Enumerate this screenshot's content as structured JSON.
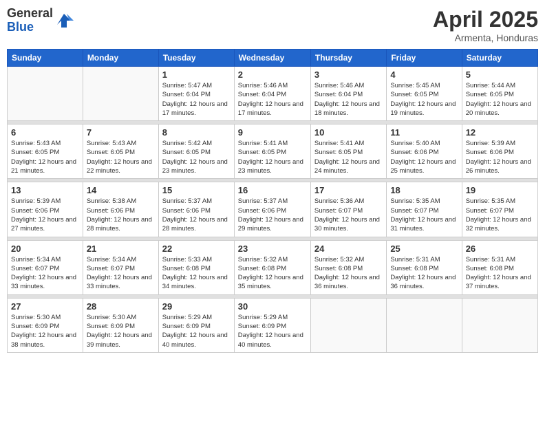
{
  "header": {
    "logo_general": "General",
    "logo_blue": "Blue",
    "month": "April 2025",
    "location": "Armenta, Honduras"
  },
  "days_of_week": [
    "Sunday",
    "Monday",
    "Tuesday",
    "Wednesday",
    "Thursday",
    "Friday",
    "Saturday"
  ],
  "weeks": [
    [
      {
        "day": "",
        "info": ""
      },
      {
        "day": "",
        "info": ""
      },
      {
        "day": "1",
        "info": "Sunrise: 5:47 AM\nSunset: 6:04 PM\nDaylight: 12 hours and 17 minutes."
      },
      {
        "day": "2",
        "info": "Sunrise: 5:46 AM\nSunset: 6:04 PM\nDaylight: 12 hours and 17 minutes."
      },
      {
        "day": "3",
        "info": "Sunrise: 5:46 AM\nSunset: 6:04 PM\nDaylight: 12 hours and 18 minutes."
      },
      {
        "day": "4",
        "info": "Sunrise: 5:45 AM\nSunset: 6:05 PM\nDaylight: 12 hours and 19 minutes."
      },
      {
        "day": "5",
        "info": "Sunrise: 5:44 AM\nSunset: 6:05 PM\nDaylight: 12 hours and 20 minutes."
      }
    ],
    [
      {
        "day": "6",
        "info": "Sunrise: 5:43 AM\nSunset: 6:05 PM\nDaylight: 12 hours and 21 minutes."
      },
      {
        "day": "7",
        "info": "Sunrise: 5:43 AM\nSunset: 6:05 PM\nDaylight: 12 hours and 22 minutes."
      },
      {
        "day": "8",
        "info": "Sunrise: 5:42 AM\nSunset: 6:05 PM\nDaylight: 12 hours and 23 minutes."
      },
      {
        "day": "9",
        "info": "Sunrise: 5:41 AM\nSunset: 6:05 PM\nDaylight: 12 hours and 23 minutes."
      },
      {
        "day": "10",
        "info": "Sunrise: 5:41 AM\nSunset: 6:05 PM\nDaylight: 12 hours and 24 minutes."
      },
      {
        "day": "11",
        "info": "Sunrise: 5:40 AM\nSunset: 6:06 PM\nDaylight: 12 hours and 25 minutes."
      },
      {
        "day": "12",
        "info": "Sunrise: 5:39 AM\nSunset: 6:06 PM\nDaylight: 12 hours and 26 minutes."
      }
    ],
    [
      {
        "day": "13",
        "info": "Sunrise: 5:39 AM\nSunset: 6:06 PM\nDaylight: 12 hours and 27 minutes."
      },
      {
        "day": "14",
        "info": "Sunrise: 5:38 AM\nSunset: 6:06 PM\nDaylight: 12 hours and 28 minutes."
      },
      {
        "day": "15",
        "info": "Sunrise: 5:37 AM\nSunset: 6:06 PM\nDaylight: 12 hours and 28 minutes."
      },
      {
        "day": "16",
        "info": "Sunrise: 5:37 AM\nSunset: 6:06 PM\nDaylight: 12 hours and 29 minutes."
      },
      {
        "day": "17",
        "info": "Sunrise: 5:36 AM\nSunset: 6:07 PM\nDaylight: 12 hours and 30 minutes."
      },
      {
        "day": "18",
        "info": "Sunrise: 5:35 AM\nSunset: 6:07 PM\nDaylight: 12 hours and 31 minutes."
      },
      {
        "day": "19",
        "info": "Sunrise: 5:35 AM\nSunset: 6:07 PM\nDaylight: 12 hours and 32 minutes."
      }
    ],
    [
      {
        "day": "20",
        "info": "Sunrise: 5:34 AM\nSunset: 6:07 PM\nDaylight: 12 hours and 33 minutes."
      },
      {
        "day": "21",
        "info": "Sunrise: 5:34 AM\nSunset: 6:07 PM\nDaylight: 12 hours and 33 minutes."
      },
      {
        "day": "22",
        "info": "Sunrise: 5:33 AM\nSunset: 6:08 PM\nDaylight: 12 hours and 34 minutes."
      },
      {
        "day": "23",
        "info": "Sunrise: 5:32 AM\nSunset: 6:08 PM\nDaylight: 12 hours and 35 minutes."
      },
      {
        "day": "24",
        "info": "Sunrise: 5:32 AM\nSunset: 6:08 PM\nDaylight: 12 hours and 36 minutes."
      },
      {
        "day": "25",
        "info": "Sunrise: 5:31 AM\nSunset: 6:08 PM\nDaylight: 12 hours and 36 minutes."
      },
      {
        "day": "26",
        "info": "Sunrise: 5:31 AM\nSunset: 6:08 PM\nDaylight: 12 hours and 37 minutes."
      }
    ],
    [
      {
        "day": "27",
        "info": "Sunrise: 5:30 AM\nSunset: 6:09 PM\nDaylight: 12 hours and 38 minutes."
      },
      {
        "day": "28",
        "info": "Sunrise: 5:30 AM\nSunset: 6:09 PM\nDaylight: 12 hours and 39 minutes."
      },
      {
        "day": "29",
        "info": "Sunrise: 5:29 AM\nSunset: 6:09 PM\nDaylight: 12 hours and 40 minutes."
      },
      {
        "day": "30",
        "info": "Sunrise: 5:29 AM\nSunset: 6:09 PM\nDaylight: 12 hours and 40 minutes."
      },
      {
        "day": "",
        "info": ""
      },
      {
        "day": "",
        "info": ""
      },
      {
        "day": "",
        "info": ""
      }
    ]
  ]
}
